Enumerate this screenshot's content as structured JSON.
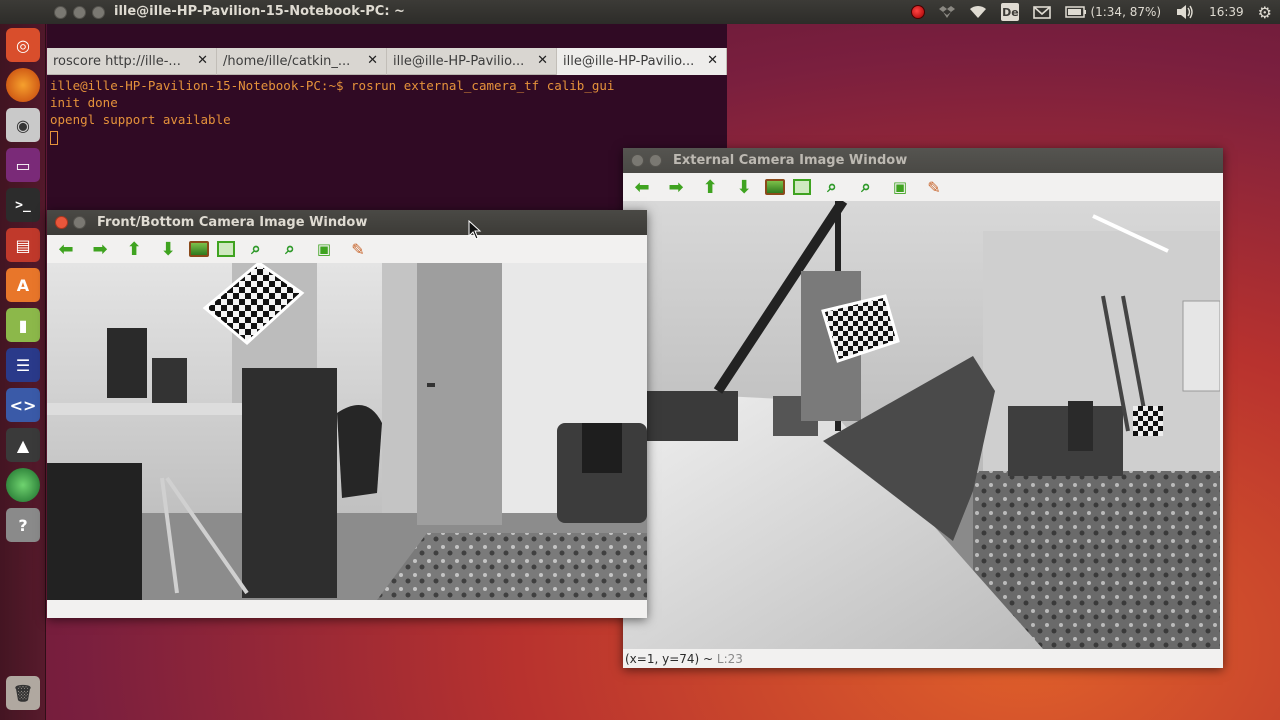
{
  "top_panel": {
    "window_title": "ille@ille-HP-Pavilion-15-Notebook-PC: ~",
    "keyboard_layout": "De",
    "battery": "(1:34, 87%)",
    "time": "16:39",
    "icons": [
      "record-icon",
      "dropbox-icon",
      "wifi-icon",
      "keyboard-icon",
      "mail-icon",
      "battery-icon",
      "volume-icon",
      "settings-gear-icon"
    ]
  },
  "launcher": {
    "items": [
      "ubuntu-dash-icon",
      "firefox-icon",
      "camera-icon",
      "screen-icon",
      "terminal-icon",
      "files-icon",
      "software-center-icon",
      "file-manager-icon",
      "monitor-icon",
      "code-editor-icon",
      "rviz-icon",
      "globe-icon",
      "help-icon",
      "trash-icon"
    ]
  },
  "terminal": {
    "tabs": [
      {
        "label": "roscore http://ille-..."
      },
      {
        "label": "/home/ille/catkin_..."
      },
      {
        "label": "ille@ille-HP-Pavilio..."
      },
      {
        "label": "ille@ille-HP-Pavilio..."
      }
    ],
    "lines": [
      "ille@ille-HP-Pavilion-15-Notebook-PC:~$ rosrun external_camera_tf calib_gui",
      "init done",
      "opengl support available"
    ],
    "colors": {
      "background": "#300a24",
      "text": "#e5923b"
    }
  },
  "front_window": {
    "title": "Front/Bottom Camera Image Window"
  },
  "external_window": {
    "title": "External Camera Image Window",
    "status_coords": "(x=1, y=74) ~",
    "status_value": "L:23"
  },
  "toolbar_icons": [
    "arrow-left-icon",
    "arrow-right-icon",
    "arrow-up-icon",
    "arrow-down-icon",
    "image-icon",
    "zoom-fit-icon",
    "zoom-in-icon",
    "zoom-out-icon",
    "save-icon",
    "clear-brush-icon"
  ]
}
